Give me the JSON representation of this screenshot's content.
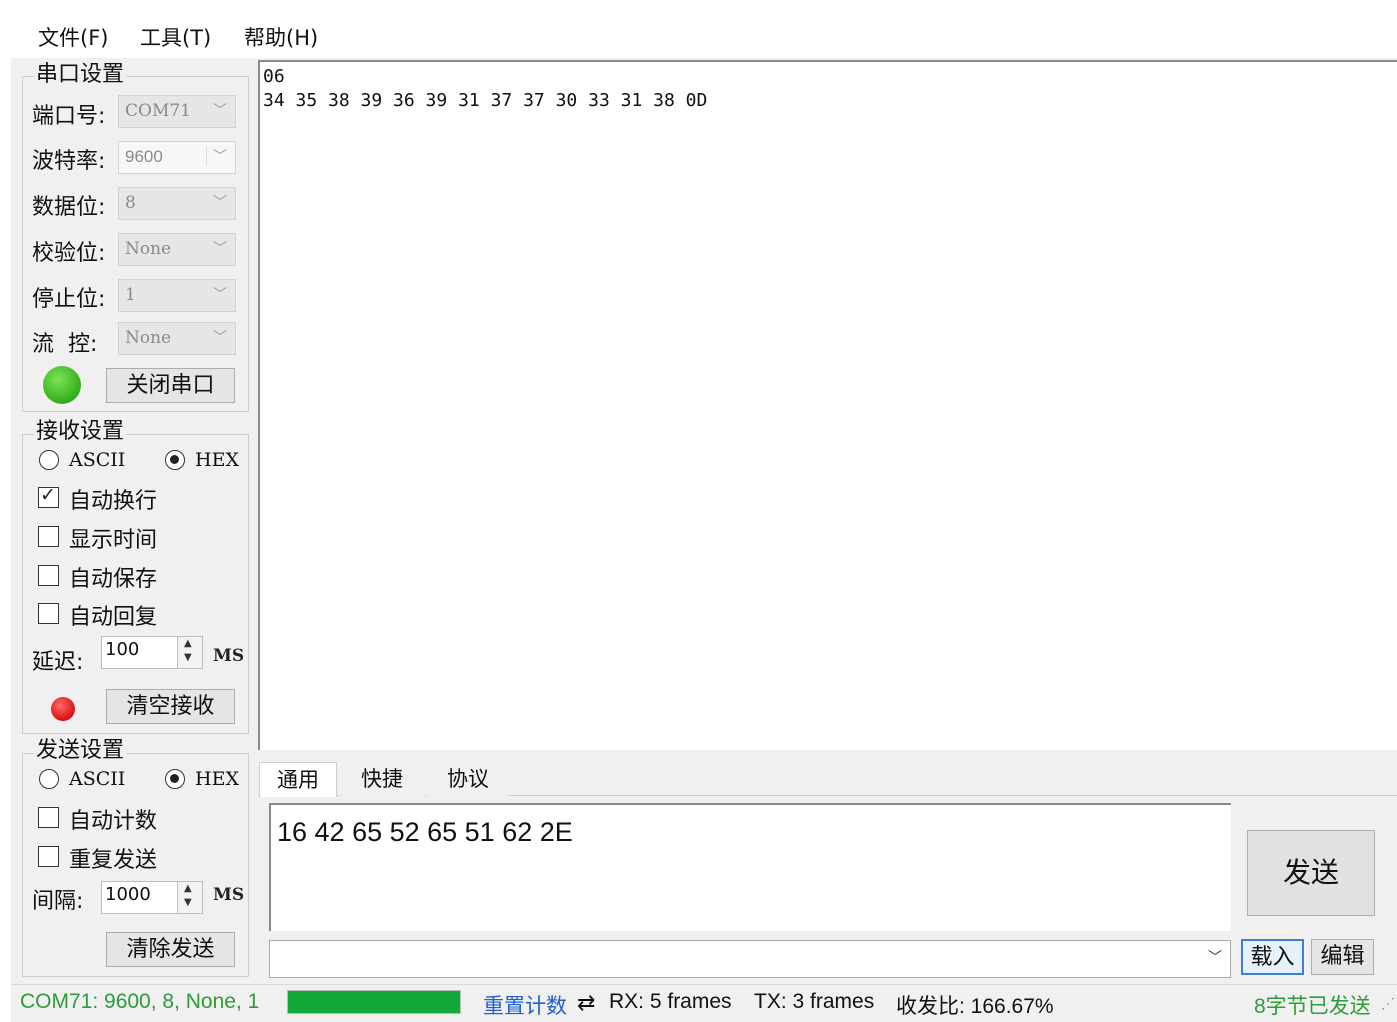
{
  "menu": [
    "文件(F)",
    "工具(T)",
    "帮助(H)"
  ],
  "serial": {
    "title": "串口设置",
    "port_label": "端口号:",
    "port": "COM71",
    "baud_label": "波特率:",
    "baud": "9600",
    "data_label": "数据位:",
    "data_bits": "8",
    "parity_label": "校验位:",
    "parity": "None",
    "stop_label": "停止位:",
    "stop_bits": "1",
    "flow_label": "流  控:",
    "flow": "None",
    "toggle_button": "关闭串口",
    "status_color": "#3cb521"
  },
  "receive": {
    "title": "接收设置",
    "ascii": "ASCII",
    "hex": "HEX",
    "mode": "HEX",
    "auto_wrap": "自动换行",
    "show_time": "显示时间",
    "auto_save": "自动保存",
    "auto_reply": "自动回复",
    "delay_label": "延迟:",
    "delay": "100",
    "delay_unit": "MS",
    "clear_button": "清空接收",
    "indicator_color": "#e01b1b"
  },
  "send": {
    "title": "发送设置",
    "ascii": "ASCII",
    "hex": "HEX",
    "mode": "HEX",
    "auto_count": "自动计数",
    "repeat": "重复发送",
    "interval_label": "间隔:",
    "interval": "1000",
    "interval_unit": "MS",
    "clear_button": "清除发送"
  },
  "recv_lines": [
    "06",
    "34 35 38 39 36 39 31 37 37 30 33 31 38 0D"
  ],
  "tabs": [
    "通用",
    "快捷",
    "协议"
  ],
  "send_text": "16 42 65 52 65 51 62 2E",
  "send_button": "发送",
  "load_button": "载入",
  "edit_button": "编辑",
  "statusbar": {
    "port_info": "COM71: 9600, 8, None, 1",
    "reset": "重置计数",
    "rx": "RX: 5 frames",
    "tx": "TX: 3 frames",
    "ratio": "收发比: 166.67%",
    "sent_info": "8字节已发送",
    "progress": 1.0,
    "progress_color": "#12a83a",
    "port_info_color": "#2e9b3a",
    "reset_color": "#1f5fd1"
  }
}
